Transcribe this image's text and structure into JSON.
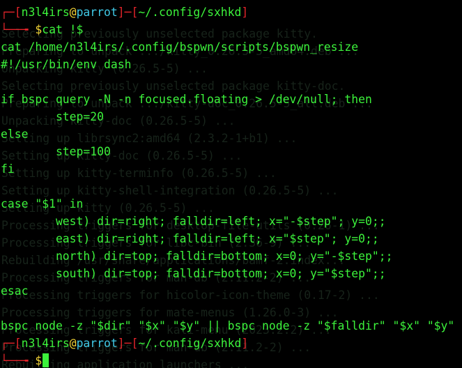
{
  "ghost_lines": [
    "Selecting previously unselected package kitty.",
    "Preparing to unpack .../kitty_0.26.5-5_amd64.deb ...",
    "Unpacking kitty (0.26.5-5) ...",
    "Selecting previously unselected package kitty-doc.",
    "Preparing to unpack .../kitty-doc_0.26.5-5_all.deb ...",
    "Unpacking kitty-doc (0.26.5-5) ...",
    "Setting up librsync2:amd64 (2.3.2-1+b1) ...",
    "Setting up kitty-doc (0.26.5-5) ...",
    "Setting up kitty-terminfo (0.26.5-5) ...",
    "Setting up kitty-shell-integration (0.26.5-5) ...",
    "Setting up kitty (0.26.5-5) ...",
    "Processing triggers for desktop-file-utils (0.26-1) ...",
    "Processing triggers for libc-bin (2.36-9) ...",
    "Rebuilding /usr/share/applications/bamf-2.index...",
    "Processing triggers for man-db (2.11.2-2) ...",
    "Processing triggers for hicolor-icon-theme (0.17-2) ...",
    "Processing triggers for mate-menus (1.26.0-3) ...",
    "Processing triggers for kali-menu (2023.2.2) ...",
    "Processing triggers for man-db (2.11.2-2) ...",
    "Rebuilding application launchers ..."
  ],
  "prompt1": {
    "bracket_open": "┌─[",
    "user": "n3l4irs",
    "at": "@",
    "host": "parrot",
    "sep": "]─[",
    "path": "~/.config/sxhkd",
    "bracket_close": "]",
    "corner": "└──╼ ",
    "symbol": "$",
    "command": "cat !$"
  },
  "output_lines": [
    "cat /home/n3l4irs/.config/bspwn/scripts/bspwn_resize",
    "#!/usr/bin/env dash",
    "",
    "if bspc query -N -n focused.floating > /dev/null; then",
    "        step=20",
    "else",
    "        step=100",
    "fi",
    "",
    "case \"$1\" in",
    "        west) dir=right; falldir=left; x=\"-$step\"; y=0;;",
    "        east) dir=right; falldir=left; x=\"$step\"; y=0;;",
    "        north) dir=top; falldir=bottom; x=0; y=\"-$step\";;",
    "        south) dir=top; falldir=bottom; x=0; y=\"$step\";;",
    "esac",
    "",
    "bspc node -z \"$dir\" \"$x\" \"$y\" || bspc node -z \"$falldir\" \"$x\" \"$y\""
  ],
  "prompt2": {
    "bracket_open": "┌─[",
    "user": "n3l4irs",
    "at": "@",
    "host": "parrot",
    "sep": "]─[",
    "path": "~/.config/sxhkd",
    "bracket_close": "]",
    "corner": "└──╼ ",
    "symbol": "$",
    "command": ""
  },
  "colors": {
    "background": "#000000",
    "text_green": "#3cf23b",
    "prompt_red": "#e3242a",
    "host_cyan": "#40c9e6",
    "prompt_yellow": "#f2d335",
    "ghost_text": "#17231a"
  }
}
